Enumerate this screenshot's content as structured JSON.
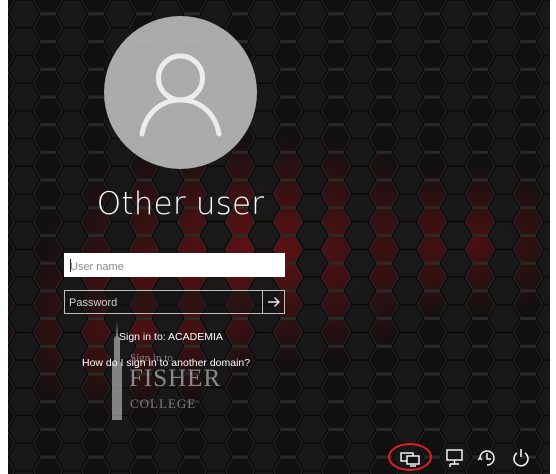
{
  "user": {
    "avatar_icon": "user-silhouette-icon",
    "title": "Other user"
  },
  "login": {
    "username_placeholder": "User name",
    "username_value": "",
    "password_placeholder": "Password",
    "password_value": "",
    "submit_icon": "arrow-right-icon"
  },
  "domain": {
    "sign_in_to": "Sign in to: ACADEMIA",
    "other_domain_link": "How do I sign in to another domain?"
  },
  "watermark": {
    "sign_text": "Sign in to",
    "name": "FISHER",
    "college": "COLLEGE"
  },
  "tray": {
    "buttons": [
      {
        "icon": "other-user-icon",
        "highlighted": true
      },
      {
        "icon": "network-icon",
        "highlighted": false
      },
      {
        "icon": "ease-of-access-icon",
        "highlighted": false
      },
      {
        "icon": "power-icon",
        "highlighted": false
      }
    ],
    "highlight_color": "#e02020"
  },
  "colors": {
    "background": "#121212",
    "hex_glow": "#8a0f14",
    "text": "#ffffff",
    "avatar_circle": "#b8b8b8"
  }
}
